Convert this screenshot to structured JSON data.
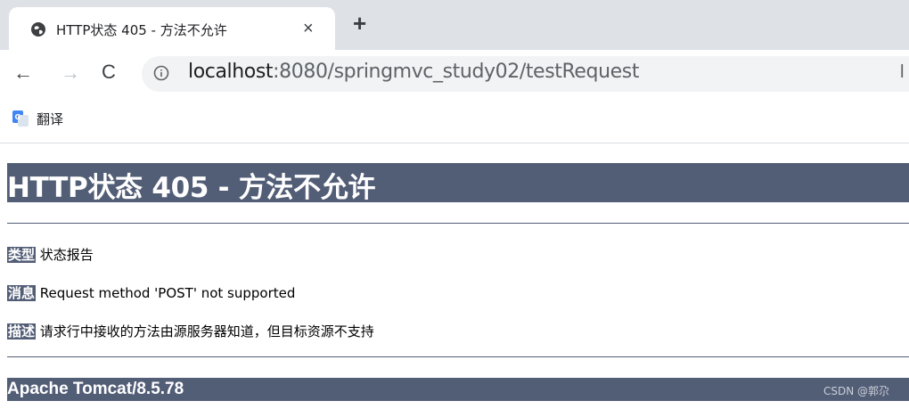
{
  "browser": {
    "tab": {
      "title": "HTTP状态 405 - 方法不允许",
      "close": "×"
    },
    "new_tab": "+",
    "nav": {
      "back": "←",
      "forward": "→",
      "reload": "C"
    },
    "url": {
      "host": "localhost",
      "rest": ":8080/springmvc_study02/testRequest"
    },
    "bookmarks": [
      {
        "label": "翻译",
        "icon": "google-translate-icon"
      }
    ]
  },
  "page": {
    "heading": "HTTP状态 405 - 方法不允许",
    "rows": [
      {
        "label": "类型",
        "text": " 状态报告"
      },
      {
        "label": "消息",
        "text": " Request method 'POST' not supported"
      },
      {
        "label": "描述",
        "text": " 请求行中接收的方法由源服务器知道，但目标资源不支持"
      }
    ],
    "footer": "Apache Tomcat/8.5.78",
    "watermark": "CSDN @郭尕"
  },
  "colors": {
    "accent": "#525d76",
    "tabstrip": "#dee1e6",
    "omnibox": "#f1f3f4"
  }
}
